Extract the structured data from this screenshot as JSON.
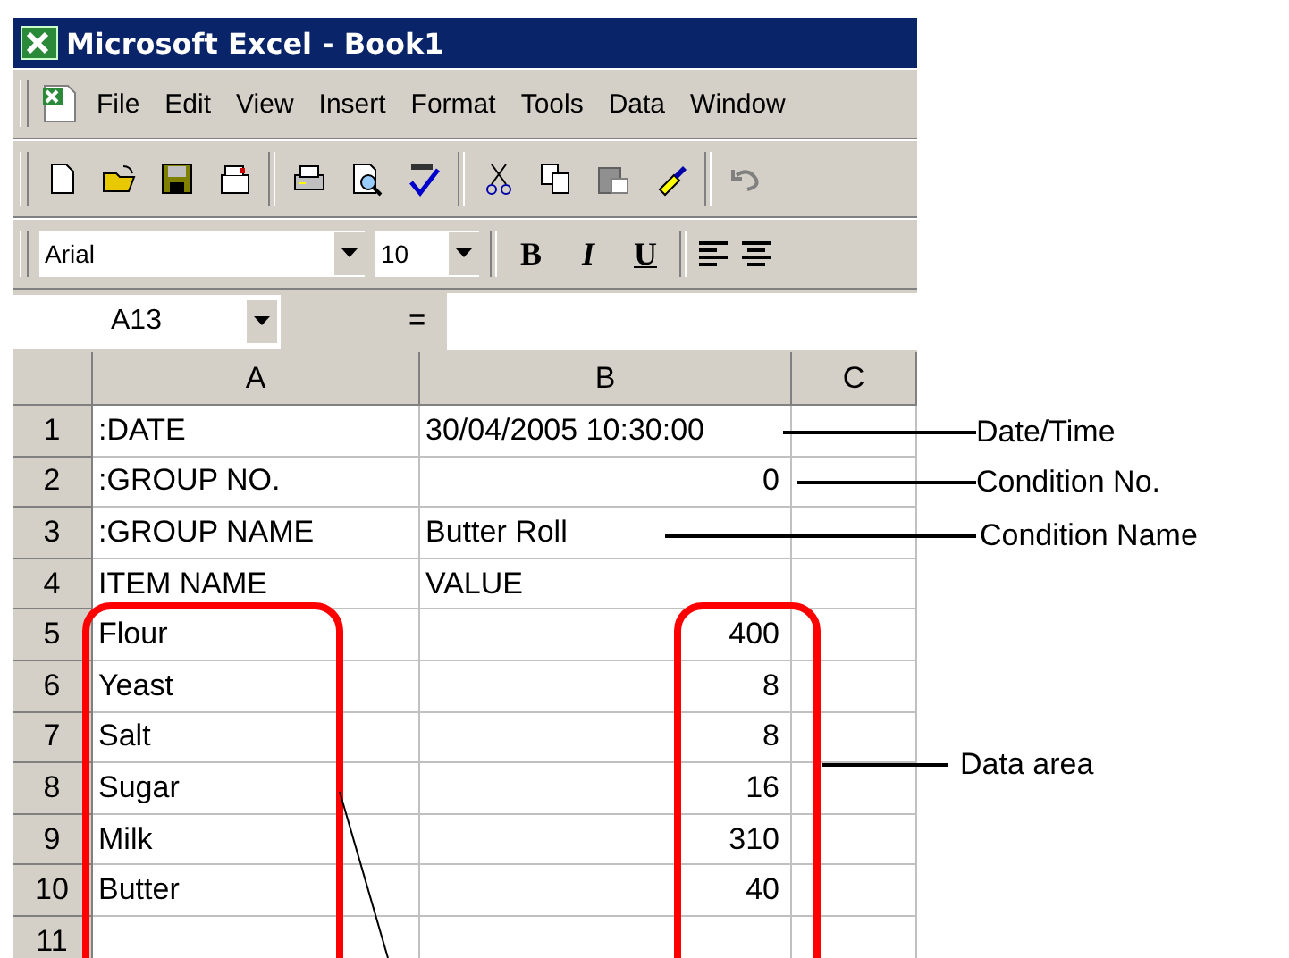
{
  "window": {
    "title": "Microsoft Excel - Book1"
  },
  "menu": [
    "File",
    "Edit",
    "View",
    "Insert",
    "Format",
    "Tools",
    "Data",
    "Window"
  ],
  "format_bar": {
    "font": "Arial",
    "size": "10",
    "style_buttons": [
      {
        "kind": "bold",
        "label": "B"
      },
      {
        "kind": "italic",
        "label": "I"
      },
      {
        "kind": "underline",
        "label": "U"
      }
    ]
  },
  "formula_bar": {
    "name_box": "A13",
    "equals": "="
  },
  "columns": [
    "A",
    "B",
    "C"
  ],
  "rows": [
    {
      "number": "1",
      "cells": [
        {
          "text": ":DATE",
          "kind": "text"
        },
        {
          "text": "30/04/2005 10:30:00",
          "kind": "text"
        }
      ]
    },
    {
      "number": "2",
      "cells": [
        {
          "text": ":GROUP NO.",
          "kind": "text"
        },
        {
          "text": "0",
          "kind": "number"
        }
      ]
    },
    {
      "number": "3",
      "cells": [
        {
          "text": ":GROUP NAME",
          "kind": "text"
        },
        {
          "text": "Butter Roll",
          "kind": "text"
        }
      ]
    },
    {
      "number": "4",
      "cells": [
        {
          "text": "ITEM NAME",
          "kind": "text"
        },
        {
          "text": "VALUE",
          "kind": "text"
        }
      ]
    },
    {
      "number": "5",
      "cells": [
        {
          "text": "Flour",
          "kind": "text"
        },
        {
          "text": "400",
          "kind": "number"
        }
      ]
    },
    {
      "number": "6",
      "cells": [
        {
          "text": "Yeast",
          "kind": "text"
        },
        {
          "text": "8",
          "kind": "number"
        }
      ]
    },
    {
      "number": "7",
      "cells": [
        {
          "text": "Salt",
          "kind": "text"
        },
        {
          "text": "8",
          "kind": "number"
        }
      ]
    },
    {
      "number": "8",
      "cells": [
        {
          "text": "Sugar",
          "kind": "text"
        },
        {
          "text": "16",
          "kind": "number"
        }
      ]
    },
    {
      "number": "9",
      "cells": [
        {
          "text": "Milk",
          "kind": "text"
        },
        {
          "text": "310",
          "kind": "number"
        }
      ]
    },
    {
      "number": "10",
      "cells": [
        {
          "text": "Butter",
          "kind": "text"
        },
        {
          "text": "40",
          "kind": "number"
        }
      ]
    },
    {
      "number": "11",
      "cells": []
    }
  ],
  "callouts": [
    "Date/Time",
    "Condition No.",
    "Condition Name",
    "Data area"
  ]
}
